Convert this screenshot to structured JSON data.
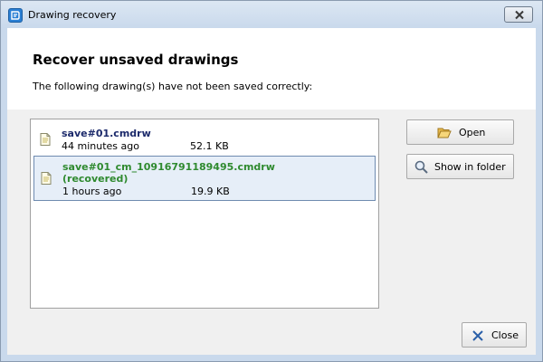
{
  "window": {
    "title": "Drawing recovery",
    "app_icon": "app-icon",
    "close_icon": "close-icon"
  },
  "header": {
    "heading": "Recover unsaved drawings",
    "subtitle": "The following drawing(s) have not been saved correctly:"
  },
  "files": [
    {
      "name": "save#01.cmdrw",
      "age": "44 minutes ago",
      "size": "52.1 KB",
      "recovered": false,
      "selected": false
    },
    {
      "name": "save#01_cm_10916791189495.cmdrw",
      "status": "(recovered)",
      "age": "1 hours ago",
      "size": "19.9 KB",
      "recovered": true,
      "selected": true
    }
  ],
  "actions": {
    "open_label": "Open",
    "open_icon": "folder-open-icon",
    "show_label": "Show in folder",
    "show_icon": "magnifier-icon",
    "close_label": "Close",
    "close_icon": "close-x-icon"
  },
  "colors": {
    "recovered_name": "#2f8a2f",
    "normal_name": "#1c2a6b",
    "selection": "#e6eef8"
  }
}
